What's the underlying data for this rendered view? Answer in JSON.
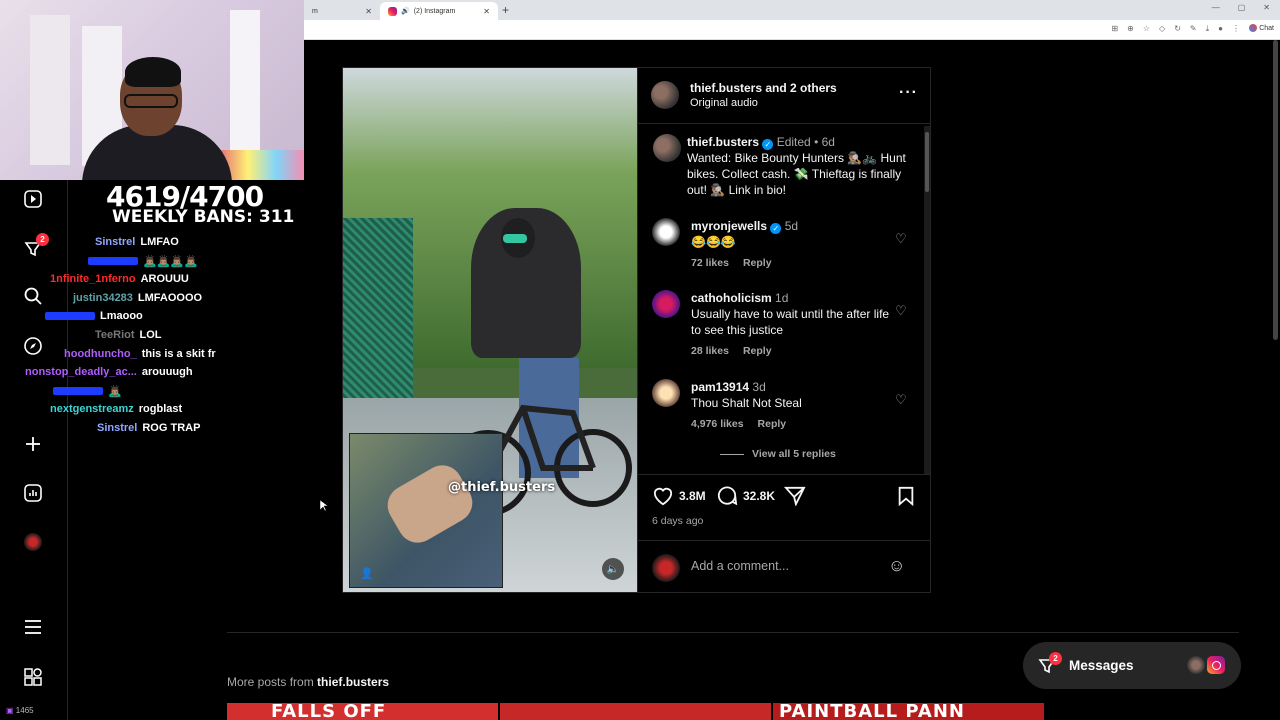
{
  "browser": {
    "tab1_label": "m",
    "tab2_label": "(2) Instagram",
    "chat_label": "Chat"
  },
  "stream": {
    "counter": "4619/4700",
    "weekly_bans": "WEEKLY BANS: 311",
    "viewers": "1465",
    "chat": [
      {
        "user": "Sinstrel",
        "msg": "LMFAO",
        "color": "#8fa8ff"
      },
      {
        "user": "",
        "msg": "🙇🏽‍♂️🙇🏽‍♂️🙇🏽‍♂️🙇🏽‍♂️",
        "color": "#1e3cff"
      },
      {
        "user": "1nfinite_1nferno",
        "msg": "AROUUU",
        "color": "#ff2a2a"
      },
      {
        "user": "justin34283",
        "msg": "LMFAOOOO",
        "color": "#5fa3a8"
      },
      {
        "user": "",
        "msg": "Lmaooo",
        "color": "#1e3cff"
      },
      {
        "user": "TeeRiot",
        "msg": "LOL",
        "color": "#777777"
      },
      {
        "user": "hoodhuncho_",
        "msg": "this is a skit fr",
        "color": "#b05cff"
      },
      {
        "user": "nonstop_deadly_ac...",
        "msg": "arouuugh",
        "color": "#b05cff"
      },
      {
        "user": "",
        "msg": "🙇🏽‍♂️",
        "color": "#1e3cff"
      },
      {
        "user": "nextgenstreamz",
        "msg": "rogblast",
        "color": "#38d6d6"
      },
      {
        "user": "Sinstrel",
        "msg": "ROG TRAP",
        "color": "#8fa8ff"
      }
    ]
  },
  "nav": {
    "icons": [
      "reels-icon",
      "filter-icon",
      "search-icon",
      "compass-icon",
      "plus-icon",
      "insights-icon",
      "profile-icon",
      "menu-icon",
      "apps-icon"
    ],
    "badge_count": "2"
  },
  "post": {
    "header_user": "thief.busters",
    "header_others": "and 2 others",
    "audio": "Original audio",
    "watermark": "@thief.busters",
    "caption_user": "thief.busters",
    "caption_edited": "Edited",
    "caption_time": "6d",
    "caption_text": "Wanted: Bike Bounty Hunters 🕵🏽‍♂️🚲 Hunt bikes. Collect cash. 💸 Thieftag is finally out! 🕵🏽‍♂️ Link in bio!",
    "comments": [
      {
        "user": "myronjewells",
        "verified": true,
        "time": "5d",
        "text": "😂😂😂",
        "likes": "72 likes",
        "reply": "Reply"
      },
      {
        "user": "cathoholicism",
        "verified": false,
        "time": "1d",
        "text": "Usually have to wait until the after life to see this justice",
        "likes": "28 likes",
        "reply": "Reply"
      },
      {
        "user": "pam13914",
        "verified": false,
        "time": "3d",
        "text": "Thou Shalt Not Steal",
        "likes": "4,976 likes",
        "reply": "Reply"
      }
    ],
    "view_replies": "View all 5 replies",
    "like_count": "3.8M",
    "comment_count": "32.8K",
    "posted_ago": "6 days ago",
    "add_comment_placeholder": "Add a comment..."
  },
  "more_posts": {
    "label": "More posts from",
    "user": "thief.busters",
    "thumb_texts": [
      "FALLS OFF",
      "",
      "PAINTBALL PANN"
    ]
  },
  "messages": {
    "label": "Messages",
    "badge": "2"
  },
  "colors": {
    "accent_red": "#ff3040",
    "verified_blue": "#0095f6",
    "panel_bg": "#000000"
  }
}
